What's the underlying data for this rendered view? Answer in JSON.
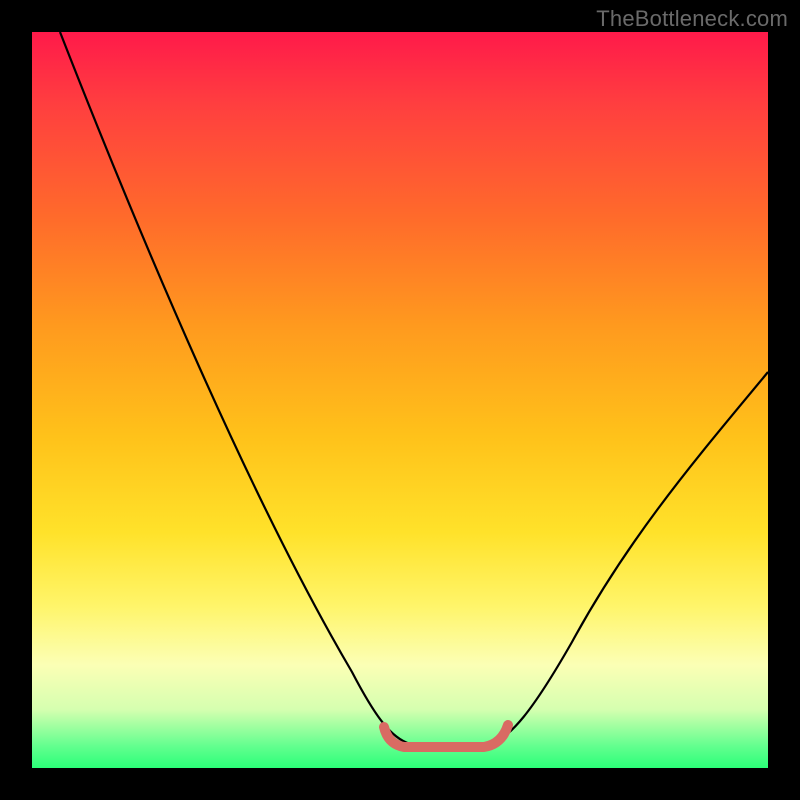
{
  "watermark": "TheBottleneck.com",
  "colors": {
    "frame": "#000000",
    "curve": "#000000",
    "highlight": "#d96b63",
    "gradient_stops": [
      "#ff1a4a",
      "#ff3f3f",
      "#ff6a2b",
      "#ff9a1e",
      "#ffc21a",
      "#ffe22a",
      "#fff56a",
      "#fbffb5",
      "#d6ffb0",
      "#63ff8f",
      "#2bff78"
    ]
  },
  "chart_data": {
    "type": "line",
    "title": "",
    "xlabel": "",
    "ylabel": "",
    "xlim": [
      0,
      100
    ],
    "ylim": [
      0,
      100
    ],
    "grid": false,
    "series": [
      {
        "name": "bottleneck-curve",
        "x": [
          0,
          5,
          10,
          15,
          20,
          25,
          30,
          35,
          40,
          45,
          49,
          51,
          53,
          55,
          57,
          59,
          61,
          63,
          68,
          75,
          82,
          90,
          100
        ],
        "y": [
          100,
          90,
          80,
          70,
          60,
          49,
          39,
          29,
          19,
          10,
          4,
          2,
          1,
          1,
          1,
          1,
          2,
          3,
          7,
          15,
          25,
          38,
          56
        ]
      }
    ],
    "annotations": [
      {
        "name": "optimal-range-marker",
        "shape": "flat-trough-highlight",
        "x_start": 48,
        "x_end": 63,
        "y": 2,
        "color": "#d96b63"
      }
    ]
  }
}
